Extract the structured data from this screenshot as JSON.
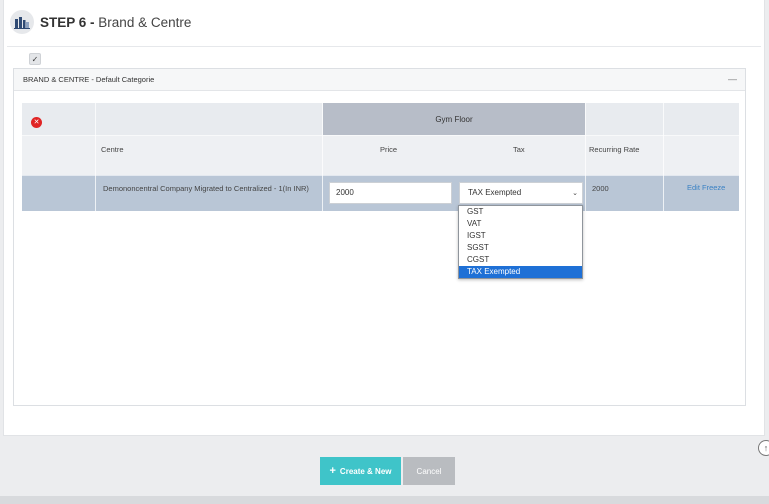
{
  "header": {
    "step_label": "STEP 6 -",
    "step_title": "Brand & Centre",
    "icon": "building-icon"
  },
  "panel": {
    "title": "BRAND & CENTRE - Default Categorie",
    "collapse_label": "—"
  },
  "table": {
    "group_header": "Gym Floor",
    "columns": {
      "centre": "Centre",
      "price": "Price",
      "tax": "Tax",
      "recurring_rate": "Recurring Rate"
    },
    "select_all_mark": "✓",
    "rows": [
      {
        "centre": "Demononcentral Company Migrated to Centralized - 1(In INR)",
        "price": "2000",
        "tax": "TAX Exempted",
        "recurring_rate": "2000",
        "action": "Edit Freeze"
      }
    ]
  },
  "tax_options": [
    "GST",
    "VAT",
    "IGST",
    "SGST",
    "CGST",
    "TAX Exempted"
  ],
  "selected_tax": "TAX Exempted",
  "footer": {
    "create_label": "Create & New",
    "cancel_label": "Cancel"
  },
  "colors": {
    "accent": "#3fc4c9",
    "group_header": "#b7bdc8",
    "row_selected": "#b9c6d6",
    "link": "#3b82c4",
    "dropdown_highlight": "#1e70d6",
    "delete": "#e02424"
  }
}
